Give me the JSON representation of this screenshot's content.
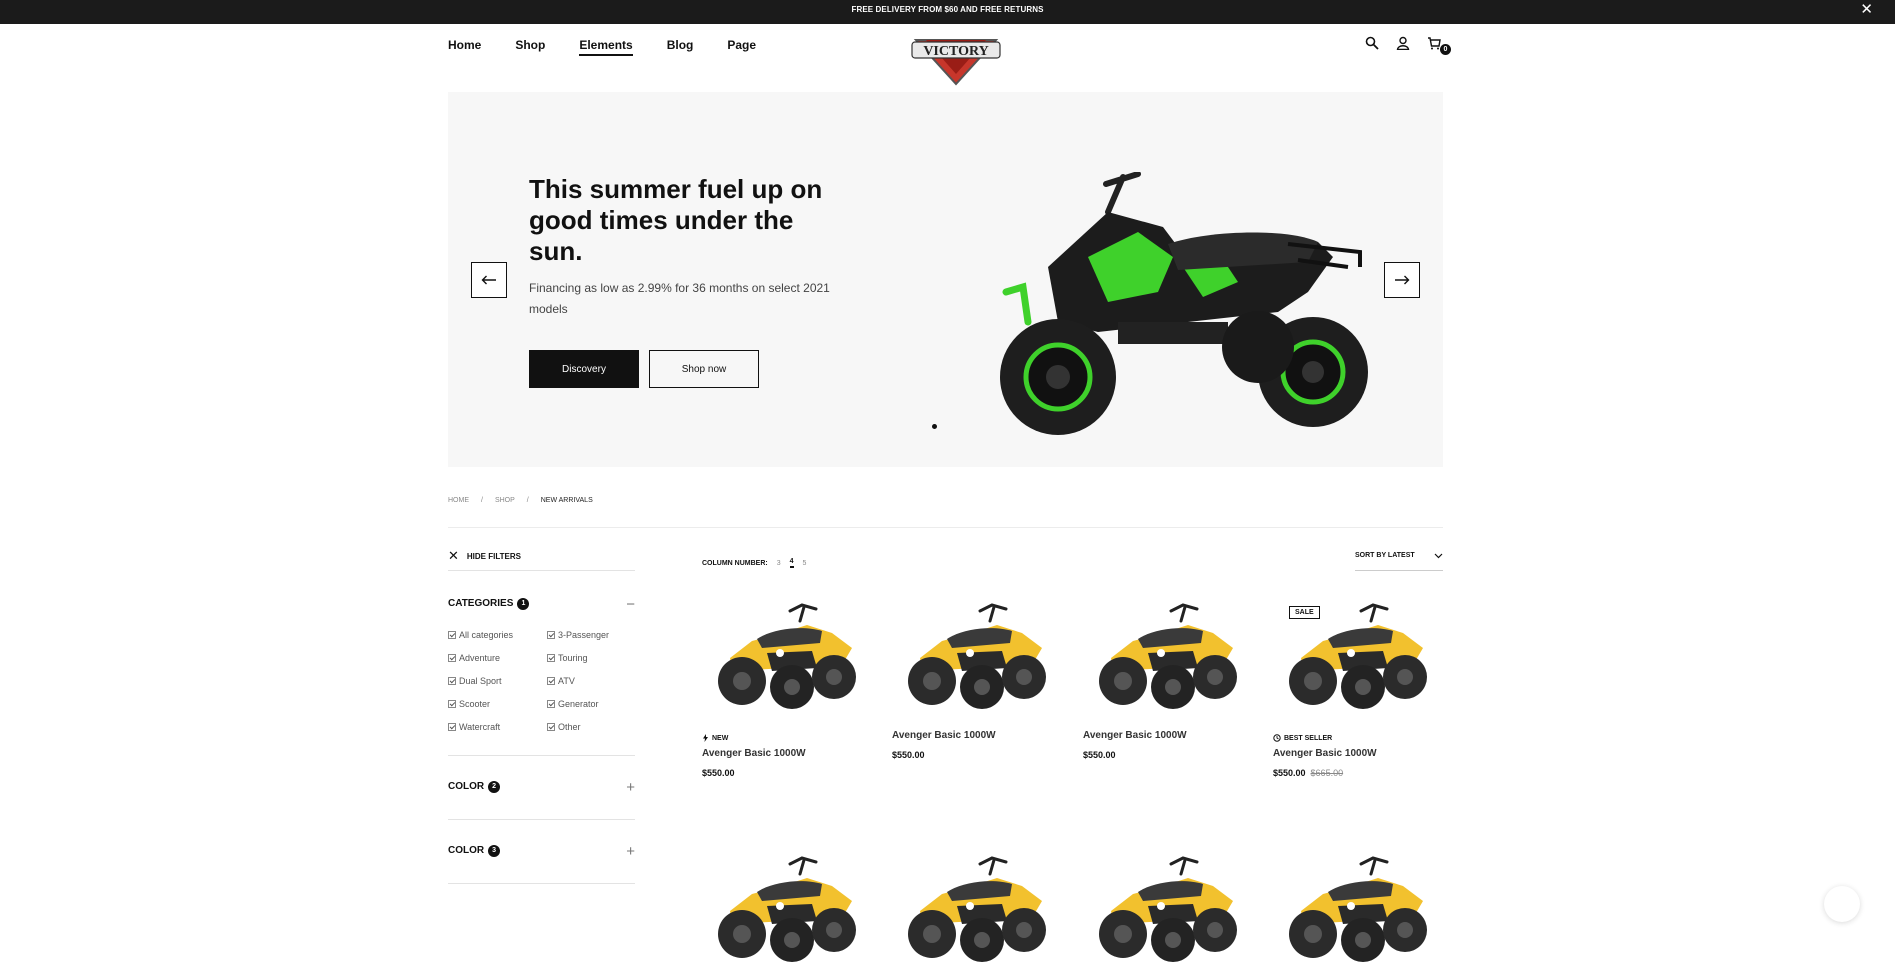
{
  "topbar": {
    "message": "FREE DELIVERY FROM $60 AND FREE RETURNS",
    "close": "✕"
  },
  "nav": {
    "items": [
      "Home",
      "Shop",
      "Elements",
      "Blog",
      "Page"
    ],
    "active": "Elements"
  },
  "logo": {
    "text": "VICTORY"
  },
  "header": {
    "icons": [
      "search-icon",
      "user-icon",
      "cart-icon"
    ],
    "cart_count": "0"
  },
  "hero": {
    "title": "This summer fuel up on good times under the sun.",
    "subtitle": "Financing as low as 2.99% for 36 months on select 2021 models",
    "btn_primary": "Discovery",
    "btn_secondary": "Shop now",
    "accent": "#3fd12b"
  },
  "breadcrumb": [
    "HOME",
    "SHOP",
    "NEW ARRIVALS"
  ],
  "filters": {
    "hide_label": "HIDE FILTERS",
    "categories_title": "CATEGORIES",
    "categories_count": "1",
    "categories": [
      "All categories",
      "3-Passenger",
      "Adventure",
      "Touring",
      "Dual Sport",
      "ATV",
      "Scooter",
      "Generator",
      "Watercraft",
      "Other"
    ],
    "color1_title": "COLOR",
    "color1_count": "2",
    "color2_title": "COLOR",
    "color2_count": "3"
  },
  "toolbar": {
    "column_label": "COLUMN NUMBER:",
    "columns": [
      "3",
      "4",
      "5"
    ],
    "active_column": "4",
    "sort_label": "SORT BY LATEST"
  },
  "products": [
    {
      "name": "Avenger Basic 1000W",
      "price": "$550.00",
      "badge": "NEW",
      "sale": "",
      "old_price": ""
    },
    {
      "name": "Avenger Basic 1000W",
      "price": "$550.00",
      "badge": "",
      "sale": "",
      "old_price": ""
    },
    {
      "name": "Avenger Basic 1000W",
      "price": "$550.00",
      "badge": "",
      "sale": "",
      "old_price": ""
    },
    {
      "name": "Avenger Basic 1000W",
      "price": "$550.00",
      "badge": "BEST SELLER",
      "sale": "SALE",
      "old_price": "$665.00"
    }
  ],
  "colors": {
    "product_yellow": "#f2c12e",
    "dark": "#111111"
  }
}
